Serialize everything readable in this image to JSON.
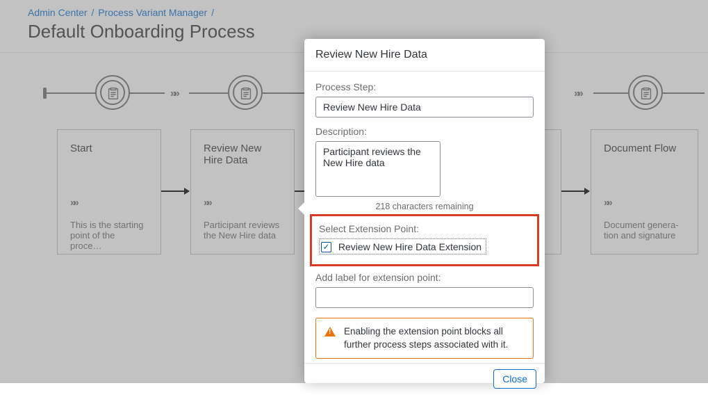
{
  "breadcrumb": {
    "admin": "Admin Center",
    "pvm": "Process Variant Manager"
  },
  "page_title": "Default Onboarding Process",
  "cards": {
    "start": {
      "title": "Start",
      "desc": "This is the starting point of the proce…"
    },
    "review": {
      "title": "Review New Hire Data",
      "desc": "Participant reviews the New Hire data"
    },
    "docflow": {
      "title": "Document Flow",
      "desc": "Document genera­tion and signature"
    }
  },
  "dialog": {
    "title": "Review New Hire Data",
    "process_step_label": "Process Step:",
    "process_step_value": "Review New Hire Data",
    "description_label": "Description:",
    "description_value": "Participant reviews the New Hire data",
    "counter": "218 characters remaining",
    "select_ext_label": "Select Extension Point:",
    "ext_checkbox_label": "Review New Hire Data Extension",
    "ext_checked": true,
    "add_label_label": "Add label for extension point:",
    "add_label_value": "",
    "warning": "Enabling the extension point blocks all further process steps associated with it.",
    "close": "Close"
  },
  "glyphs": {
    "chev": "»»",
    "check": "✓"
  }
}
